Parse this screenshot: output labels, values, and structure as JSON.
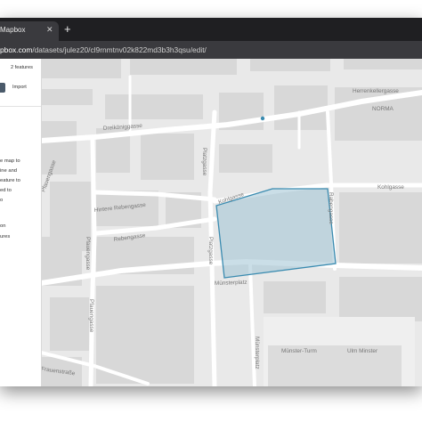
{
  "browser": {
    "tab_title": "Mapbox",
    "tab_close": "✕",
    "new_tab": "+",
    "url_host": "pbox.com",
    "url_path": "/datasets/julez20/cl9rnmtnv02k822md3b3h3qsu/edit/"
  },
  "sidebar": {
    "feature_count": "2 features",
    "import_label": "Import",
    "hint_lines": [
      "e map to",
      "ine and",
      "eature to",
      "ed to",
      "o",
      "on",
      "ures"
    ]
  },
  "map": {
    "streets": [
      "Herrenkellergasse",
      "Dreikönig­gasse",
      "Kohlgasse",
      "Kohlgasse",
      "Hintere Rebengasse",
      "Rebengasse",
      "Platzgasse",
      "Platzgasse",
      "Rabengasse",
      "Münsterplatz",
      "Münsterplatz",
      "Pfauengasse",
      "Pfauengasse",
      "Pfauengasse",
      "Frauenstraße"
    ],
    "places": [
      "NORMA",
      "Münster-Turm",
      "Ulm Minster"
    ],
    "polygon_fill": "#9fc3d4",
    "polygon_stroke": "#3a8bb0",
    "marker_color": "#3a8bb0"
  }
}
